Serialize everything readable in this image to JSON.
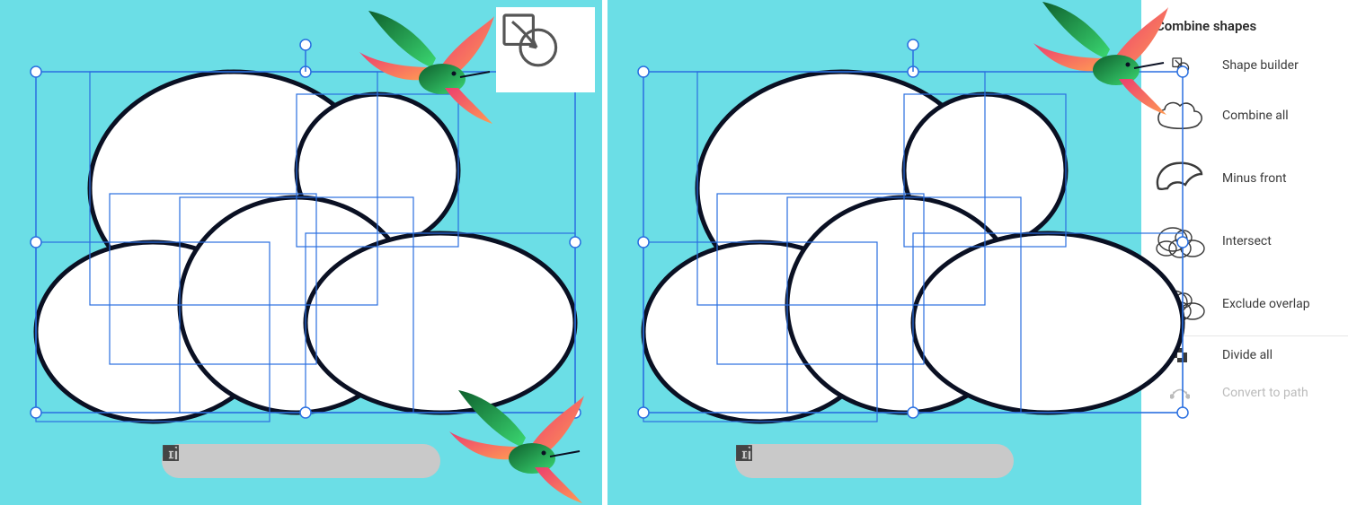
{
  "panel": {
    "title": "Combine shapes",
    "items": [
      {
        "id": "shape-builder",
        "label": "Shape builder"
      },
      {
        "id": "combine-all",
        "label": "Combine all"
      },
      {
        "id": "minus-front",
        "label": "Minus front"
      },
      {
        "id": "intersect",
        "label": "Intersect"
      },
      {
        "id": "exclude-overlap",
        "label": "Exclude overlap"
      },
      {
        "id": "divide-all",
        "label": "Divide all"
      },
      {
        "id": "convert-to-path",
        "label": "Convert to path",
        "disabled": true
      }
    ]
  },
  "context_toolbar": {
    "items": [
      {
        "id": "transparency",
        "name": "transparency-grid-icon"
      },
      {
        "id": "stroke",
        "name": "stroke-weight-icon"
      },
      {
        "id": "arrange",
        "name": "arrange-layers-icon"
      },
      {
        "id": "move",
        "name": "move-icon"
      },
      {
        "id": "lock",
        "name": "unlock-icon"
      },
      {
        "id": "group",
        "name": "group-icon"
      },
      {
        "id": "duplicate",
        "name": "duplicate-icon"
      },
      {
        "id": "delete",
        "name": "trash-icon"
      }
    ]
  },
  "canvas": {
    "background": "#6bdee6",
    "selection_stroke": "#2a6fe0",
    "shape_fill": "#ffffff",
    "shape_stroke": "#0a1023",
    "shape_stroke_width": 5
  },
  "badge_icon": "shape-builder-icon",
  "colors": {
    "bird_red": "#ec3d6f",
    "bird_green": "#169a4a",
    "bird_dark": "#0e5f2d"
  }
}
